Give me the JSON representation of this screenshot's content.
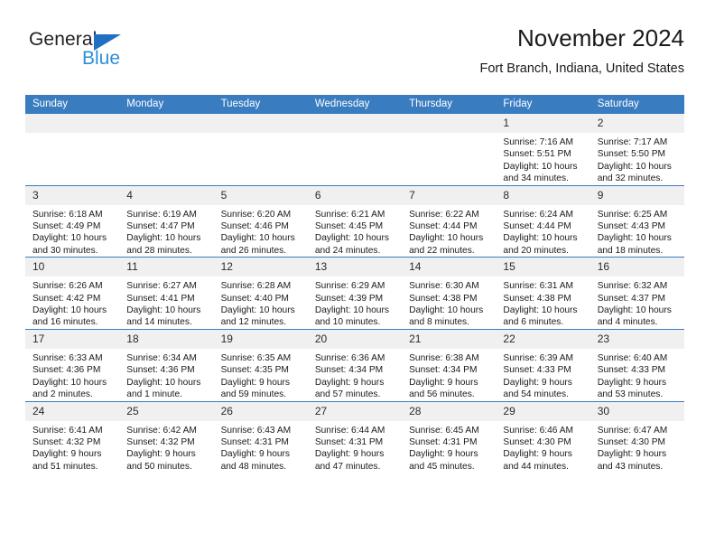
{
  "brand": {
    "name_part1": "General",
    "name_part2": "Blue",
    "triangle_color": "#1f6fc4",
    "blue_color": "#2b8fd8"
  },
  "header": {
    "title": "November 2024",
    "location": "Fort Branch, Indiana, United States"
  },
  "theme": {
    "header_bg": "#3a7cc0",
    "daynum_bg": "#f0f0f0",
    "row_divider": "#3a7cc0",
    "text": "#1a1a1a"
  },
  "weekday_headers": [
    "Sunday",
    "Monday",
    "Tuesday",
    "Wednesday",
    "Thursday",
    "Friday",
    "Saturday"
  ],
  "weeks": [
    [
      {
        "day": "",
        "sunrise": "",
        "sunset": "",
        "daylight": ""
      },
      {
        "day": "",
        "sunrise": "",
        "sunset": "",
        "daylight": ""
      },
      {
        "day": "",
        "sunrise": "",
        "sunset": "",
        "daylight": ""
      },
      {
        "day": "",
        "sunrise": "",
        "sunset": "",
        "daylight": ""
      },
      {
        "day": "",
        "sunrise": "",
        "sunset": "",
        "daylight": ""
      },
      {
        "day": "1",
        "sunrise": "Sunrise: 7:16 AM",
        "sunset": "Sunset: 5:51 PM",
        "daylight": "Daylight: 10 hours and 34 minutes."
      },
      {
        "day": "2",
        "sunrise": "Sunrise: 7:17 AM",
        "sunset": "Sunset: 5:50 PM",
        "daylight": "Daylight: 10 hours and 32 minutes."
      }
    ],
    [
      {
        "day": "3",
        "sunrise": "Sunrise: 6:18 AM",
        "sunset": "Sunset: 4:49 PM",
        "daylight": "Daylight: 10 hours and 30 minutes."
      },
      {
        "day": "4",
        "sunrise": "Sunrise: 6:19 AM",
        "sunset": "Sunset: 4:47 PM",
        "daylight": "Daylight: 10 hours and 28 minutes."
      },
      {
        "day": "5",
        "sunrise": "Sunrise: 6:20 AM",
        "sunset": "Sunset: 4:46 PM",
        "daylight": "Daylight: 10 hours and 26 minutes."
      },
      {
        "day": "6",
        "sunrise": "Sunrise: 6:21 AM",
        "sunset": "Sunset: 4:45 PM",
        "daylight": "Daylight: 10 hours and 24 minutes."
      },
      {
        "day": "7",
        "sunrise": "Sunrise: 6:22 AM",
        "sunset": "Sunset: 4:44 PM",
        "daylight": "Daylight: 10 hours and 22 minutes."
      },
      {
        "day": "8",
        "sunrise": "Sunrise: 6:24 AM",
        "sunset": "Sunset: 4:44 PM",
        "daylight": "Daylight: 10 hours and 20 minutes."
      },
      {
        "day": "9",
        "sunrise": "Sunrise: 6:25 AM",
        "sunset": "Sunset: 4:43 PM",
        "daylight": "Daylight: 10 hours and 18 minutes."
      }
    ],
    [
      {
        "day": "10",
        "sunrise": "Sunrise: 6:26 AM",
        "sunset": "Sunset: 4:42 PM",
        "daylight": "Daylight: 10 hours and 16 minutes."
      },
      {
        "day": "11",
        "sunrise": "Sunrise: 6:27 AM",
        "sunset": "Sunset: 4:41 PM",
        "daylight": "Daylight: 10 hours and 14 minutes."
      },
      {
        "day": "12",
        "sunrise": "Sunrise: 6:28 AM",
        "sunset": "Sunset: 4:40 PM",
        "daylight": "Daylight: 10 hours and 12 minutes."
      },
      {
        "day": "13",
        "sunrise": "Sunrise: 6:29 AM",
        "sunset": "Sunset: 4:39 PM",
        "daylight": "Daylight: 10 hours and 10 minutes."
      },
      {
        "day": "14",
        "sunrise": "Sunrise: 6:30 AM",
        "sunset": "Sunset: 4:38 PM",
        "daylight": "Daylight: 10 hours and 8 minutes."
      },
      {
        "day": "15",
        "sunrise": "Sunrise: 6:31 AM",
        "sunset": "Sunset: 4:38 PM",
        "daylight": "Daylight: 10 hours and 6 minutes."
      },
      {
        "day": "16",
        "sunrise": "Sunrise: 6:32 AM",
        "sunset": "Sunset: 4:37 PM",
        "daylight": "Daylight: 10 hours and 4 minutes."
      }
    ],
    [
      {
        "day": "17",
        "sunrise": "Sunrise: 6:33 AM",
        "sunset": "Sunset: 4:36 PM",
        "daylight": "Daylight: 10 hours and 2 minutes."
      },
      {
        "day": "18",
        "sunrise": "Sunrise: 6:34 AM",
        "sunset": "Sunset: 4:36 PM",
        "daylight": "Daylight: 10 hours and 1 minute."
      },
      {
        "day": "19",
        "sunrise": "Sunrise: 6:35 AM",
        "sunset": "Sunset: 4:35 PM",
        "daylight": "Daylight: 9 hours and 59 minutes."
      },
      {
        "day": "20",
        "sunrise": "Sunrise: 6:36 AM",
        "sunset": "Sunset: 4:34 PM",
        "daylight": "Daylight: 9 hours and 57 minutes."
      },
      {
        "day": "21",
        "sunrise": "Sunrise: 6:38 AM",
        "sunset": "Sunset: 4:34 PM",
        "daylight": "Daylight: 9 hours and 56 minutes."
      },
      {
        "day": "22",
        "sunrise": "Sunrise: 6:39 AM",
        "sunset": "Sunset: 4:33 PM",
        "daylight": "Daylight: 9 hours and 54 minutes."
      },
      {
        "day": "23",
        "sunrise": "Sunrise: 6:40 AM",
        "sunset": "Sunset: 4:33 PM",
        "daylight": "Daylight: 9 hours and 53 minutes."
      }
    ],
    [
      {
        "day": "24",
        "sunrise": "Sunrise: 6:41 AM",
        "sunset": "Sunset: 4:32 PM",
        "daylight": "Daylight: 9 hours and 51 minutes."
      },
      {
        "day": "25",
        "sunrise": "Sunrise: 6:42 AM",
        "sunset": "Sunset: 4:32 PM",
        "daylight": "Daylight: 9 hours and 50 minutes."
      },
      {
        "day": "26",
        "sunrise": "Sunrise: 6:43 AM",
        "sunset": "Sunset: 4:31 PM",
        "daylight": "Daylight: 9 hours and 48 minutes."
      },
      {
        "day": "27",
        "sunrise": "Sunrise: 6:44 AM",
        "sunset": "Sunset: 4:31 PM",
        "daylight": "Daylight: 9 hours and 47 minutes."
      },
      {
        "day": "28",
        "sunrise": "Sunrise: 6:45 AM",
        "sunset": "Sunset: 4:31 PM",
        "daylight": "Daylight: 9 hours and 45 minutes."
      },
      {
        "day": "29",
        "sunrise": "Sunrise: 6:46 AM",
        "sunset": "Sunset: 4:30 PM",
        "daylight": "Daylight: 9 hours and 44 minutes."
      },
      {
        "day": "30",
        "sunrise": "Sunrise: 6:47 AM",
        "sunset": "Sunset: 4:30 PM",
        "daylight": "Daylight: 9 hours and 43 minutes."
      }
    ]
  ]
}
